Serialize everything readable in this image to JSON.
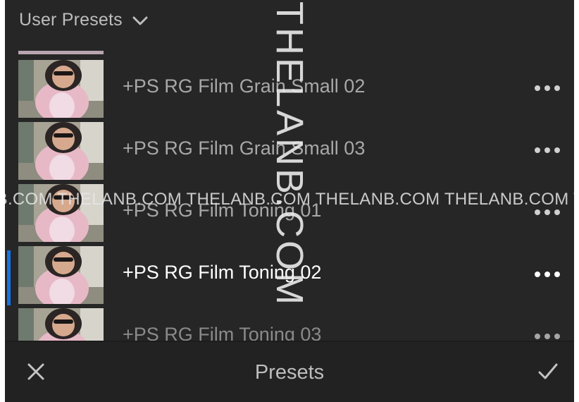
{
  "header": {
    "title": "User Presets",
    "dropdown_icon": "chevron-down-icon"
  },
  "presets": [
    {
      "label": "+PS RG Film Grain Small 02",
      "selected": false
    },
    {
      "label": "+PS RG Film Grain Small 03",
      "selected": false
    },
    {
      "label": "+PS RG Film Toning 01",
      "selected": false
    },
    {
      "label": "+PS RG Film Toning 02",
      "selected": true
    },
    {
      "label": "+PS RG Film Toning 03",
      "selected": false
    }
  ],
  "bottom_bar": {
    "title": "Presets",
    "close_icon": "close-icon",
    "done_icon": "checkmark-icon"
  },
  "watermark": {
    "horizontal": "NB.COM THELANB.COM THELANB.COM THELANB.COM THELANB.COM THELAN",
    "vertical": "THELANB.COM"
  },
  "colors": {
    "background": "#262626",
    "accent": "#1473e6",
    "text": "#bdbdbd",
    "selected_text": "#ffffff"
  }
}
